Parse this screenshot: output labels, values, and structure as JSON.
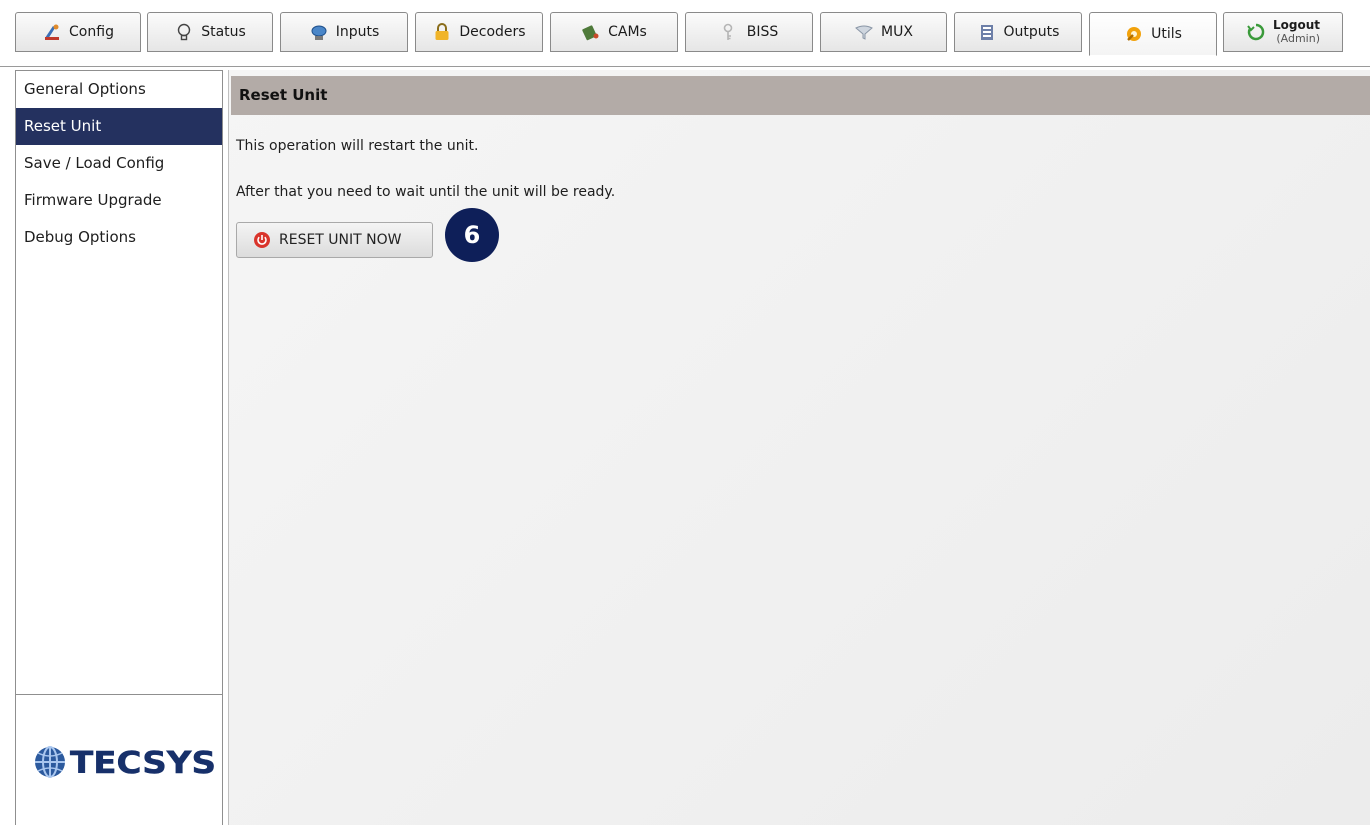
{
  "tabs": [
    {
      "id": "config",
      "label": "Config",
      "icon": "config-icon"
    },
    {
      "id": "status",
      "label": "Status",
      "icon": "lightbulb-icon"
    },
    {
      "id": "inputs",
      "label": "Inputs",
      "icon": "satellite-dish-icon"
    },
    {
      "id": "decoders",
      "label": "Decoders",
      "icon": "lock-icon"
    },
    {
      "id": "cams",
      "label": "CAMs",
      "icon": "card-icon"
    },
    {
      "id": "biss",
      "label": "BISS",
      "icon": "key-icon"
    },
    {
      "id": "mux",
      "label": "MUX",
      "icon": "funnel-icon"
    },
    {
      "id": "outputs",
      "label": "Outputs",
      "icon": "document-icon"
    },
    {
      "id": "utils",
      "label": "Utils",
      "icon": "tools-icon",
      "active": true
    }
  ],
  "logout": {
    "label": "Logout",
    "user": "(Admin)",
    "icon": "logout-icon"
  },
  "sidebar": {
    "items": [
      {
        "label": "General Options"
      },
      {
        "label": "Reset Unit",
        "selected": true
      },
      {
        "label": "Save / Load Config"
      },
      {
        "label": "Firmware Upgrade"
      },
      {
        "label": "Debug Options"
      }
    ]
  },
  "logo": {
    "text": "TECSYS",
    "icon": "globe-icon"
  },
  "main": {
    "section_title": "Reset Unit",
    "text1": "This operation will restart the unit.",
    "text2": "After that you need to wait until the unit will be ready.",
    "reset_button_label": "RESET UNIT NOW",
    "reset_button_icon": "power-icon",
    "step_badge": "6"
  },
  "colors": {
    "selected_nav": "#24315f",
    "section_header": "#b3aba7",
    "badge": "#0e1f59"
  }
}
